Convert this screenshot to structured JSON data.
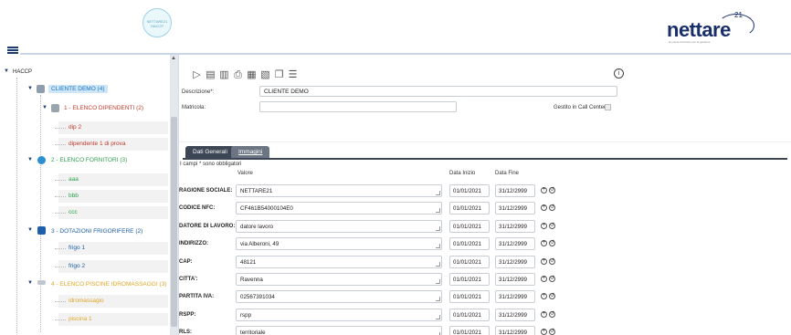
{
  "header": {
    "logo_badge_text": "NETTARE21 HACCP",
    "brand_word": "nettare",
    "brand_sup": "21",
    "brand_tagline": "la nuova soluzione per la gestione"
  },
  "sidebar": {
    "root_label": "HACCP",
    "items": [
      {
        "label": "CLIENTE DEMO (4)",
        "color": "#1976c4"
      },
      {
        "label": "1 - ELENCO DIPENDENTI (2)",
        "color": "#c0392b"
      },
      {
        "label": "dip 2",
        "color": "#c0392b"
      },
      {
        "label": "dipendente 1 di prova",
        "color": "#c0392b"
      },
      {
        "label": "2 - ELENCO FORNITORI (3)",
        "color": "#2e9e4f"
      },
      {
        "label": "aaa",
        "color": "#2e9e4f"
      },
      {
        "label": "bbb",
        "color": "#2e9e4f"
      },
      {
        "label": "ccc",
        "color": "#2e9e4f"
      },
      {
        "label": "3 - DOTAZIONI FRIGORIFERE (2)",
        "color": "#1d5fa8"
      },
      {
        "label": "frigo 1",
        "color": "#1d5fa8"
      },
      {
        "label": "frigo 2",
        "color": "#1d5fa8"
      },
      {
        "label": "4 - ELENCO PISCINE IDROMASSAGGI (3)",
        "color": "#e0a526"
      },
      {
        "label": "idromassagio",
        "color": "#e0a526"
      },
      {
        "label": "piscina 1",
        "color": "#e0a526"
      }
    ]
  },
  "form": {
    "descrizione_label": "Descrizione*:",
    "descrizione_value": "CLIENTE DEMO",
    "matricola_label": "Matricola:",
    "matricola_value": "",
    "gestito_label": "Gestito in Call Center:"
  },
  "tabs": [
    {
      "label": "Dati Generali"
    },
    {
      "label": "Immagini"
    }
  ],
  "grid": {
    "required_note": "I campi * sono obbligatori",
    "col_valore": "Valore",
    "col_data_inizio": "Data Inizio",
    "col_data_fine": "Data Fine",
    "rows": [
      {
        "label": "RAGIONE SOCIALE:",
        "value": "NETTARE21",
        "start": "01/01/2021",
        "end": "31/12/2999"
      },
      {
        "label": "CODICE NFC:",
        "value": "CF461B54000104E0",
        "start": "01/01/2021",
        "end": "31/12/2999"
      },
      {
        "label": "DATORE DI LAVORO:",
        "value": "datore lavoro",
        "start": "01/01/2021",
        "end": "31/12/2999"
      },
      {
        "label": "INDIRIZZO:",
        "value": "via Alberoni, 49",
        "start": "01/01/2021",
        "end": "31/12/2999"
      },
      {
        "label": "CAP:",
        "value": "48121",
        "start": "01/01/2021",
        "end": "31/12/2999"
      },
      {
        "label": "CITTA':",
        "value": "Ravenna",
        "start": "01/01/2021",
        "end": "31/12/2999"
      },
      {
        "label": "PARTITA IVA:",
        "value": "02567391034",
        "start": "01/01/2021",
        "end": "31/12/2999"
      },
      {
        "label": "RSPP:",
        "value": "rspp",
        "start": "01/01/2021",
        "end": "31/12/2999"
      },
      {
        "label": "RLS:",
        "value": "territoriale",
        "start": "01/01/2021",
        "end": "31/12/2999"
      }
    ]
  }
}
